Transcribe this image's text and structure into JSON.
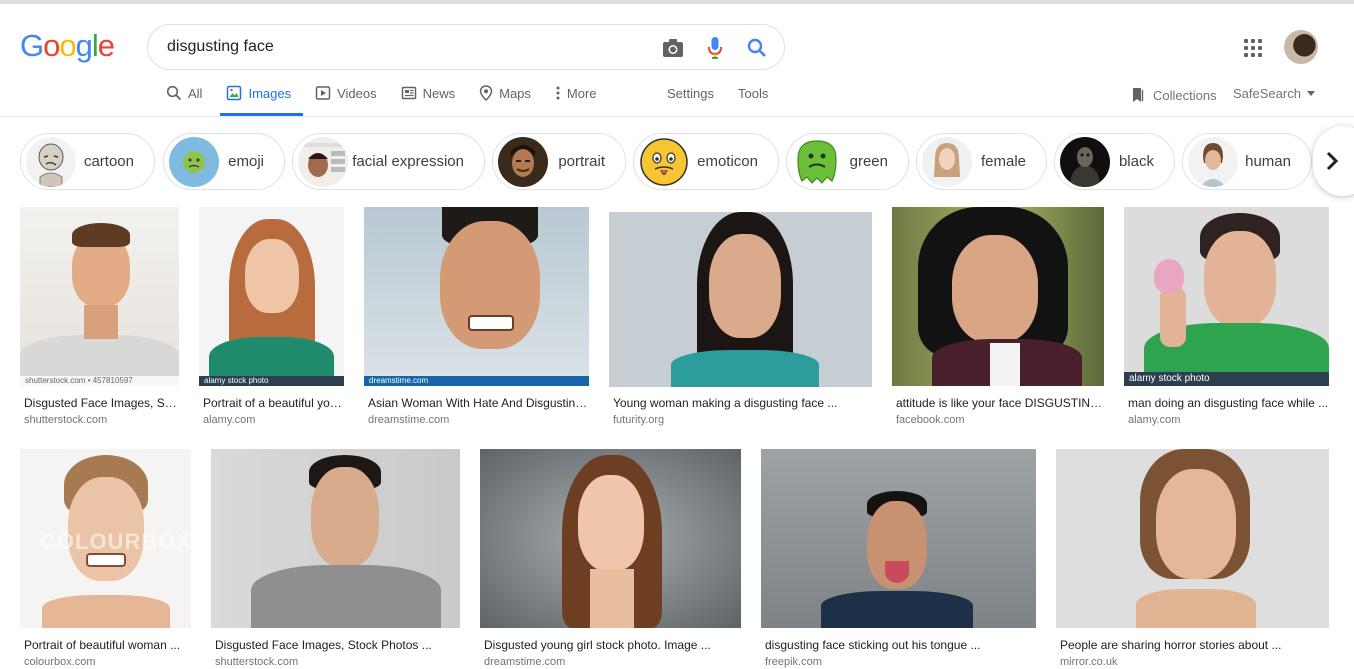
{
  "search": {
    "query": "disgusting face",
    "camera_icon": "camera-icon",
    "mic_icon": "mic-icon",
    "search_icon": "search-icon"
  },
  "logo": {
    "letters": [
      "G",
      "o",
      "o",
      "g",
      "l",
      "e"
    ],
    "colors": [
      "#4285f4",
      "#ea4335",
      "#fbbc05",
      "#4285f4",
      "#34a853",
      "#ea4335"
    ]
  },
  "tabs": [
    {
      "label": "All",
      "icon": "search-icon"
    },
    {
      "label": "Images",
      "icon": "image-icon",
      "active": true
    },
    {
      "label": "Videos",
      "icon": "video-icon"
    },
    {
      "label": "News",
      "icon": "news-icon"
    },
    {
      "label": "Maps",
      "icon": "map-pin-icon"
    },
    {
      "label": "More",
      "icon": "more-vert-icon"
    }
  ],
  "tools": {
    "settings": "Settings",
    "tools": "Tools",
    "collections": "Collections",
    "safesearch": "SafeSearch"
  },
  "chips": [
    {
      "label": "cartoon"
    },
    {
      "label": "emoji"
    },
    {
      "label": "facial expression"
    },
    {
      "label": "portrait"
    },
    {
      "label": "emoticon"
    },
    {
      "label": "green"
    },
    {
      "label": "female"
    },
    {
      "label": "black"
    },
    {
      "label": "human"
    }
  ],
  "results": [
    {
      "title": "Disgusted Face Images, Stock Photos ...",
      "source": "shutterstock.com",
      "watermark": "shutterstock.com • 457810597"
    },
    {
      "title": "Portrait of a beautiful young ...",
      "source": "alamy.com",
      "watermark": "alamy stock photo"
    },
    {
      "title": "Asian Woman With Hate And Disgusting ...",
      "source": "dreamstime.com",
      "watermark": "dreamstime.com"
    },
    {
      "title": "Young woman making a disgusting face ...",
      "source": "futurity.org"
    },
    {
      "title": "attitude is like your face DISGUSTING ...",
      "source": "facebook.com"
    },
    {
      "title": "man doing an disgusting face while ...",
      "source": "alamy.com",
      "watermark": "alamy stock photo"
    },
    {
      "title": "Portrait of beautiful woman ...",
      "source": "colourbox.com",
      "watermark": "COLOURBOX"
    },
    {
      "title": "Disgusted Face Images, Stock Photos ...",
      "source": "shutterstock.com"
    },
    {
      "title": "Disgusted young girl stock photo. Image ...",
      "source": "dreamstime.com"
    },
    {
      "title": "disgusting face sticking out his tongue ...",
      "source": "freepik.com"
    },
    {
      "title": "People are sharing horror stories about ...",
      "source": "mirror.co.uk"
    }
  ],
  "colors": {
    "accent": "#1a73e8",
    "text": "#202124",
    "muted": "#70757a"
  }
}
